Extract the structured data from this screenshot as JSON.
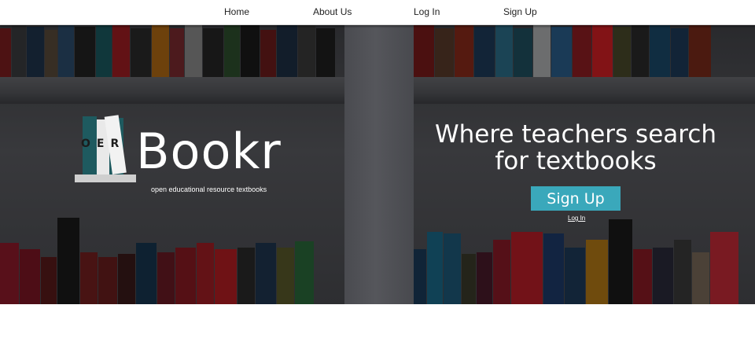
{
  "nav": {
    "home": "Home",
    "about": "About Us",
    "login": "Log In",
    "signup": "Sign Up"
  },
  "logo": {
    "oer": "OER",
    "word": "Bookr",
    "tagline": "open educational resource textbooks"
  },
  "hero": {
    "headline": "Where teachers search for textbooks",
    "cta": "Sign Up",
    "login": "Log In"
  },
  "colors": {
    "accent": "#3aa8bb",
    "logo_book": "#1e5a5f",
    "hero_bg": "#3e3f43"
  }
}
